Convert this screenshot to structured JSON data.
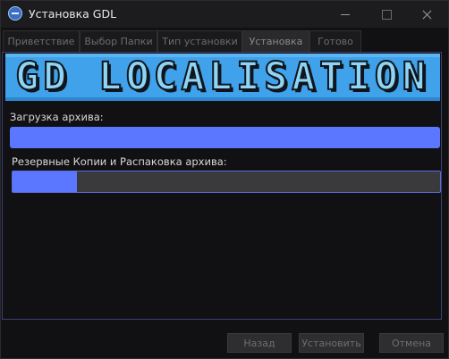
{
  "window": {
    "title": "Установка GDL"
  },
  "tabs": [
    {
      "label": "Приветствие"
    },
    {
      "label": "Выбор Папки"
    },
    {
      "label": "Тип установки"
    },
    {
      "label": "Установка",
      "active": true
    },
    {
      "label": "Готово"
    }
  ],
  "banner": {
    "text": "GD LOCALISATION"
  },
  "progress": {
    "archive_label": "Загрузка архива:",
    "archive_fraction": 1.0,
    "backup_label": "Резервные Копии и Распаковка архива:",
    "backup_fraction": 0.15
  },
  "buttons": {
    "back": "Назад",
    "install": "Установить",
    "cancel": "Отмена"
  },
  "colors": {
    "accent": "#5b77ff",
    "banner_bg": "#3fa2ea",
    "panel_border": "#3a3f78"
  }
}
